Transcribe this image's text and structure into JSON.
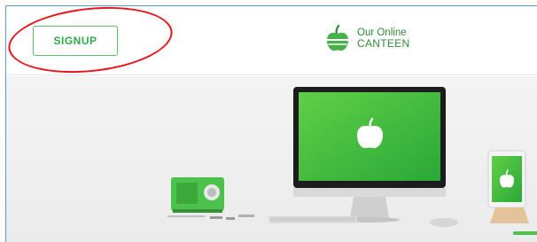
{
  "header": {
    "signup_label": "SIGNUP",
    "brand_line1": "Our Online",
    "brand_line2": "CANTEEN"
  },
  "colors": {
    "accent_green": "#2eaa4a",
    "annotation_red": "#e8151b",
    "frame_blue": "#5b9bd5"
  },
  "icons": {
    "logo": "apple-icon",
    "monitor_screen": "apple-icon",
    "tablet_screen": "apple-icon"
  }
}
